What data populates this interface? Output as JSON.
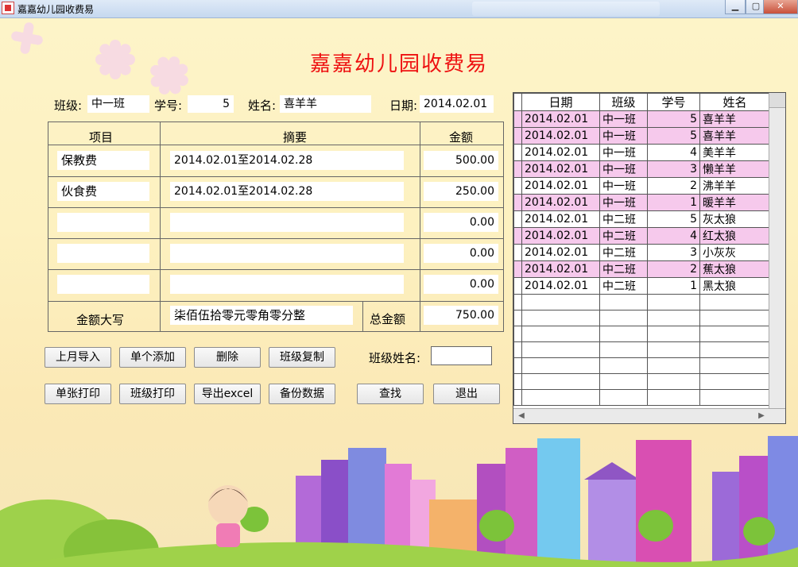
{
  "window": {
    "title": "嘉嘉幼儿园收费易",
    "buttons": {
      "minimize": "▁",
      "maximize": "▢",
      "close": "✕"
    }
  },
  "heading": "嘉嘉幼儿园收费易",
  "form": {
    "class_label": "班级:",
    "class_value": "中一班",
    "id_label": "学号:",
    "id_value": "5",
    "name_label": "姓名:",
    "name_value": "喜羊羊",
    "date_label": "日期:",
    "date_value": "2014.02.01"
  },
  "fee_table": {
    "headers": [
      "项目",
      "摘要",
      "金额"
    ],
    "rows": [
      {
        "item": "保教费",
        "summary": "2014.02.01至2014.02.28",
        "amount": "500.00"
      },
      {
        "item": "伙食费",
        "summary": "2014.02.01至2014.02.28",
        "amount": "250.00"
      },
      {
        "item": "",
        "summary": "",
        "amount": "0.00"
      },
      {
        "item": "",
        "summary": "",
        "amount": "0.00"
      },
      {
        "item": "",
        "summary": "",
        "amount": "0.00"
      }
    ],
    "caps_label": "金额大写",
    "caps_value": "柒佰伍拾零元零角零分整",
    "total_label": "总金额",
    "total_value": "750.00"
  },
  "buttons": {
    "import_last_month": "上月导入",
    "add_single": "单个添加",
    "delete": "删除",
    "copy_class": "班级复制",
    "print_single": "单张打印",
    "print_class": "班级打印",
    "export_excel": "导出excel",
    "backup": "备份数据",
    "search": "查找",
    "exit": "退出"
  },
  "search": {
    "label": "班级姓名:",
    "value": ""
  },
  "records": {
    "headers": [
      "日期",
      "班级",
      "学号",
      "姓名"
    ],
    "rows": [
      {
        "date": "2014.02.01",
        "class": "中一班",
        "id": "5",
        "name": "喜羊羊",
        "highlight": true
      },
      {
        "date": "2014.02.01",
        "class": "中一班",
        "id": "5",
        "name": "喜羊羊",
        "highlight": true
      },
      {
        "date": "2014.02.01",
        "class": "中一班",
        "id": "4",
        "name": "美羊羊",
        "highlight": false
      },
      {
        "date": "2014.02.01",
        "class": "中一班",
        "id": "3",
        "name": "懒羊羊",
        "highlight": true
      },
      {
        "date": "2014.02.01",
        "class": "中一班",
        "id": "2",
        "name": "沸羊羊",
        "highlight": false
      },
      {
        "date": "2014.02.01",
        "class": "中一班",
        "id": "1",
        "name": "暖羊羊",
        "highlight": true
      },
      {
        "date": "2014.02.01",
        "class": "中二班",
        "id": "5",
        "name": "灰太狼",
        "highlight": false
      },
      {
        "date": "2014.02.01",
        "class": "中二班",
        "id": "4",
        "name": "红太狼",
        "highlight": true
      },
      {
        "date": "2014.02.01",
        "class": "中二班",
        "id": "3",
        "name": "小灰灰",
        "highlight": false
      },
      {
        "date": "2014.02.01",
        "class": "中二班",
        "id": "2",
        "name": "蕉太狼",
        "highlight": true
      },
      {
        "date": "2014.02.01",
        "class": "中二班",
        "id": "1",
        "name": "黑太狼",
        "highlight": false
      }
    ],
    "empty_rows": 7
  },
  "colors": {
    "accent_title": "#e11111",
    "row_highlight": "#f6c9ec"
  }
}
